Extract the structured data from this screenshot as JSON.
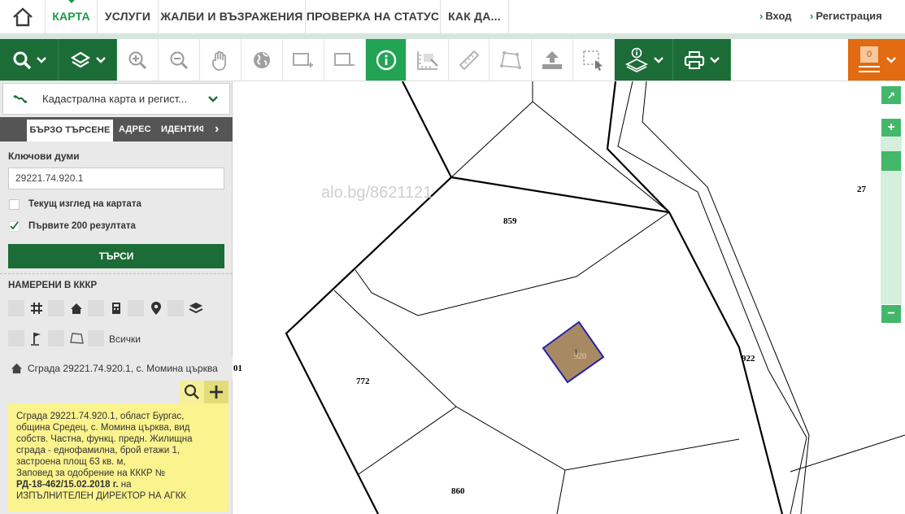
{
  "nav": {
    "items": [
      "КАРТА",
      "УСЛУГИ",
      "ЖАЛБИ И ВЪЗРАЖЕНИЯ",
      "ПРОВЕРКА НА СТАТУС",
      "КАК ДА..."
    ],
    "login": "Вход",
    "register": "Регистрация"
  },
  "toolbar": {
    "icons": [
      "search-icon",
      "layers-icon",
      "zoom-in-icon",
      "zoom-out-icon",
      "pan-hand-icon",
      "globe-icon",
      "extent-add-icon",
      "extent-remove-icon",
      "info-icon",
      "measure-ruler-icon",
      "ruler-icon",
      "polygon-icon",
      "upload-icon",
      "select-box-icon",
      "layer-info-icon",
      "print-icon"
    ],
    "cart_count": "0"
  },
  "sidebar": {
    "layer_label": "Кадастрална карта и регист...",
    "tabs": [
      "БЪРЗО ТЪРСЕНЕ",
      "АДРЕС",
      "ИДЕНТИФ"
    ],
    "keywords_label": "Ключови думи",
    "keywords_value": "29221.74.920.1",
    "current_view_label": "Текущ изглед на картата",
    "first200_label": "Първите 200 резултата",
    "search_button": "ТЪРСИ",
    "found_label": "НАМЕРЕНИ В КККР",
    "all_label": "Всички",
    "result_title": "Сграда 29221.74.920.1, с. Момина църква",
    "info_lines": [
      "Сграда 29221.74.920.1, област Бургас,",
      "община Средец, с. Момина църква, вид",
      "собств. Частна, функц. предн. Жилищна",
      "сграда - еднофамилна, брой етажи 1,",
      "застроена площ 63 кв. м,",
      "Заповед за одобрение на КККР №"
    ],
    "info_order_number": "РД-18-462/15.02.2018 г.",
    "info_order_suffix": " на",
    "info_last_line": "ИЗПЪЛНИТЕЛЕН ДИРЕКТОР НА АГКК"
  },
  "map": {
    "watermark": "alo.bg/8621121",
    "parcels": [
      "859",
      "772",
      "860",
      "922",
      "27",
      "920",
      "1",
      "01"
    ]
  },
  "colors": {
    "green_dark": "#1c6c38",
    "green_bright": "#23a455",
    "orange": "#e26a10",
    "highlight_fill": "#a88a62",
    "highlight_stroke": "#2222aa"
  }
}
